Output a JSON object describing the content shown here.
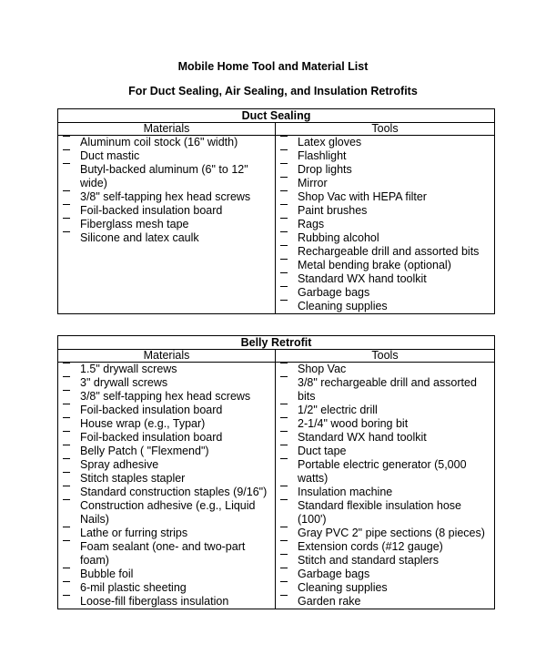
{
  "document": {
    "title": "Mobile Home Tool and Material List",
    "subtitle": "For Duct Sealing, Air Sealing, and Insulation Retrofits"
  },
  "sections": [
    {
      "heading": "Duct Sealing",
      "materials_header": "Materials",
      "tools_header": "Tools",
      "materials": [
        "Aluminum coil stock (16\" width)",
        "Duct mastic",
        "Butyl-backed aluminum (6\" to 12\" wide)",
        "3/8\" self-tapping hex head screws",
        "Foil-backed insulation board",
        "Fiberglass mesh tape",
        "Silicone and latex caulk"
      ],
      "tools": [
        "Latex gloves",
        "Flashlight",
        "Drop lights",
        "Mirror",
        "Shop Vac with HEPA filter",
        "Paint brushes",
        "Rags",
        "Rubbing alcohol",
        "Rechargeable drill and assorted bits",
        "Metal bending brake (optional)",
        "Standard WX hand toolkit",
        "Garbage bags",
        "Cleaning supplies"
      ]
    },
    {
      "heading": "Belly Retrofit",
      "materials_header": "Materials",
      "tools_header": "Tools",
      "materials": [
        "1.5\" drywall screws",
        "3\" drywall screws",
        "3/8\" self-tapping hex head screws",
        "Foil-backed insulation board",
        "House wrap (e.g., Typar)",
        "Foil-backed insulation board",
        "Belly Patch ( \"Flexmend\")",
        "Spray adhesive",
        "Stitch staples stapler",
        "Standard construction staples (9/16\")",
        "Construction adhesive (e.g., Liquid Nails)",
        "Lathe or furring strips",
        "Foam sealant (one- and two-part foam)",
        "Bubble foil",
        "6-mil plastic sheeting",
        "Loose-fill fiberglass insulation"
      ],
      "tools": [
        "Shop Vac",
        "3/8\" rechargeable drill and assorted bits",
        "1/2\" electric drill",
        "2-1/4\" wood boring bit",
        "Standard WX hand toolkit",
        "Duct tape",
        "Portable electric generator (5,000 watts)",
        "Insulation machine",
        "Standard flexible insulation hose (100')",
        "Gray PVC 2\" pipe sections (8 pieces)",
        "Extension cords (#12 gauge)",
        "Stitch and standard staplers",
        "Garbage bags",
        "Cleaning supplies",
        "Garden rake"
      ]
    }
  ]
}
